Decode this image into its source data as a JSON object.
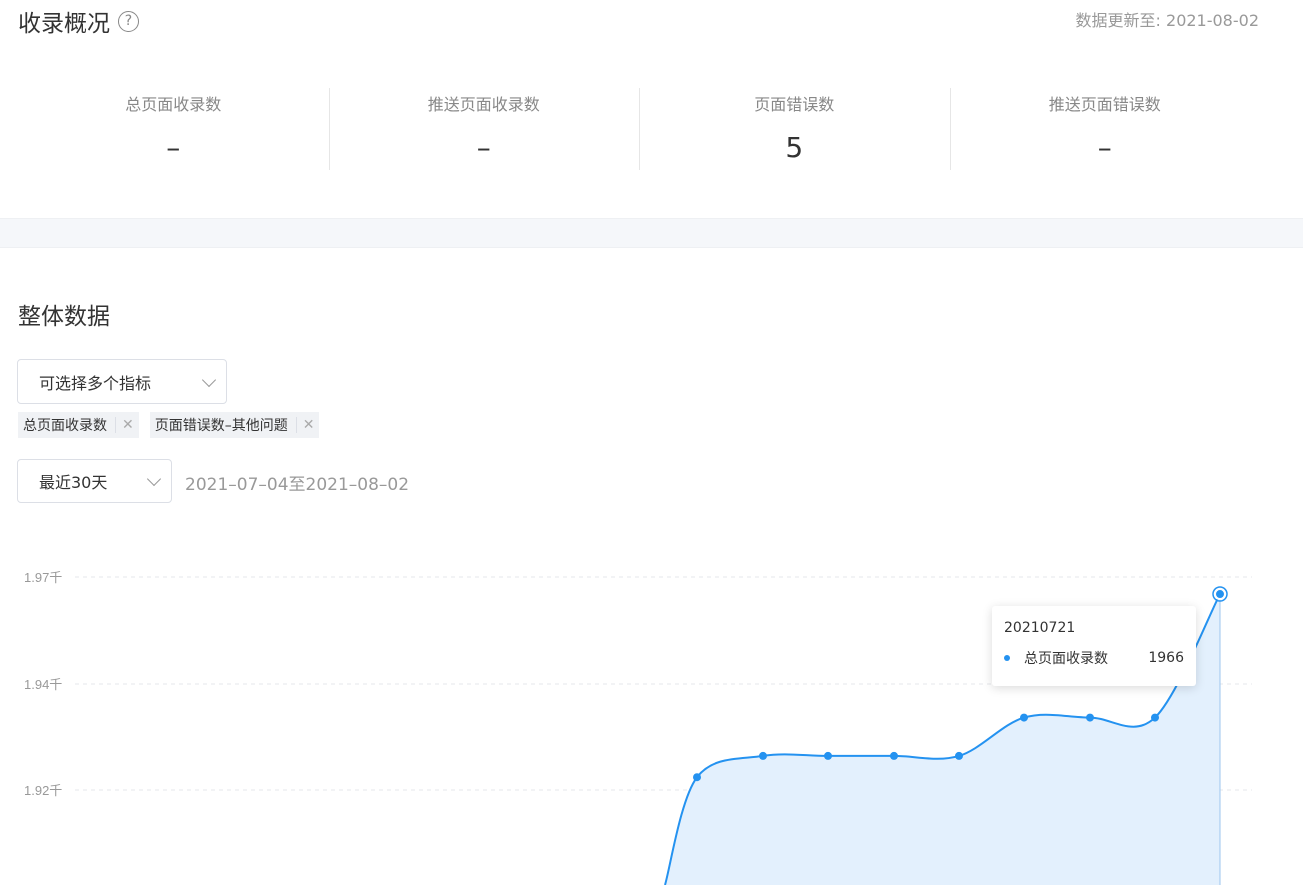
{
  "overview": {
    "title": "收录概况",
    "help_glyph": "?",
    "updated": "数据更新至: 2021-08-02",
    "stats": [
      {
        "label": "总页面收录数",
        "value": "–"
      },
      {
        "label": "推送页面收录数",
        "value": "–"
      },
      {
        "label": "页面错误数",
        "value": "5"
      },
      {
        "label": "推送页面错误数",
        "value": "–"
      }
    ]
  },
  "overall": {
    "title": "整体数据",
    "metric_select": {
      "placeholder": "可选择多个指标"
    },
    "tags": [
      {
        "label": "总页面收录数",
        "close": "✕"
      },
      {
        "label": "页面错误数–其他问题",
        "close": "✕"
      }
    ],
    "range_select": {
      "value": "最近30天"
    },
    "range_text": "2021–07–04至2021–08–02"
  },
  "chart_data": {
    "type": "area",
    "y_ticks": [
      "1.97千",
      "1.94千",
      "1.92千"
    ],
    "y_tick_values": [
      1970,
      1940,
      1920
    ],
    "series": [
      {
        "name": "总页面收录数",
        "color": "#2492f0",
        "points": [
          1923,
          1928,
          1928,
          1928,
          1928,
          1937,
          1937,
          1937,
          1966
        ]
      }
    ],
    "tooltip": {
      "date": "20210721",
      "series": "总页面收录数",
      "value": "1966"
    },
    "grid": true
  }
}
